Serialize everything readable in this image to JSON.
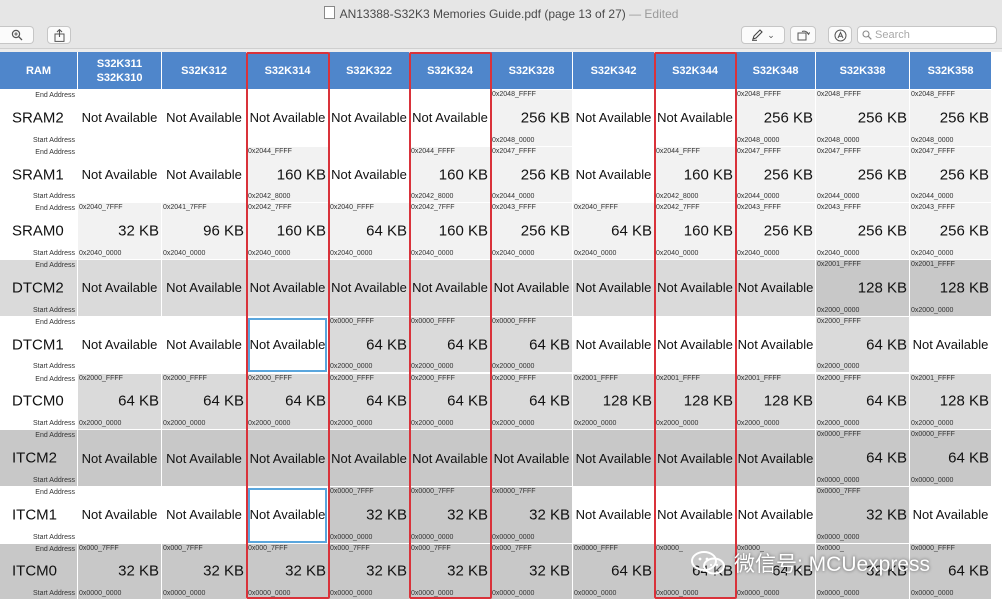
{
  "window": {
    "title": "AN13388-S32K3 Memories Guide.pdf (page 13 of 27)",
    "status": "— Edited"
  },
  "toolbar": {
    "zoom_icon": "zoom-icon",
    "share_icon": "share-icon",
    "markup_icon": "pen-icon",
    "rotate_icon": "rotate-icon",
    "annotate_icon": "annotate-icon",
    "search_placeholder": "Search"
  },
  "table": {
    "corner": "RAM",
    "end_address_label": "End Address",
    "start_address_label": "Start Address",
    "columns": [
      "S32K311\nS32K310",
      "S32K312",
      "S32K314",
      "S32K322",
      "S32K324",
      "S32K328",
      "S32K342",
      "S32K344",
      "S32K348",
      "S32K338",
      "S32K358"
    ],
    "rows": [
      {
        "name": "SRAM2",
        "cells": [
          {
            "na": "Not Available"
          },
          {
            "na": "Not Available"
          },
          {
            "na": "Not Available"
          },
          {
            "na": "Not Available"
          },
          {
            "na": "Not Available"
          },
          {
            "end": "0x2048_FFFF",
            "size": "256 KB",
            "start": "0x2048_0000"
          },
          {
            "na": "Not Available"
          },
          {
            "na": "Not Available"
          },
          {
            "end": "0x2048_FFFF",
            "size": "256 KB",
            "start": "0x2048_0000"
          },
          {
            "end": "0x2048_FFFF",
            "size": "256 KB",
            "start": "0x2048_0000"
          },
          {
            "end": "0x2048_FFFF",
            "size": "256 KB",
            "start": "0x2048_0000"
          }
        ]
      },
      {
        "name": "SRAM1",
        "cells": [
          {
            "na": "Not Available"
          },
          {
            "na": "Not Available"
          },
          {
            "end": "0x2044_FFFF",
            "size": "160 KB",
            "start": "0x2042_8000"
          },
          {
            "na": "Not Available"
          },
          {
            "end": "0x2044_FFFF",
            "size": "160 KB",
            "start": "0x2042_8000"
          },
          {
            "end": "0x2047_FFFF",
            "size": "256 KB",
            "start": "0x2044_0000"
          },
          {
            "na": "Not Available"
          },
          {
            "end": "0x2044_FFFF",
            "size": "160 KB",
            "start": "0x2042_8000"
          },
          {
            "end": "0x2047_FFFF",
            "size": "256 KB",
            "start": "0x2044_0000"
          },
          {
            "end": "0x2047_FFFF",
            "size": "256 KB",
            "start": "0x2044_0000"
          },
          {
            "end": "0x2047_FFFF",
            "size": "256 KB",
            "start": "0x2044_0000"
          }
        ]
      },
      {
        "name": "SRAM0",
        "cells": [
          {
            "end": "0x2040_7FFF",
            "size": "32 KB",
            "start": "0x2040_0000"
          },
          {
            "end": "0x2041_7FFF",
            "size": "96 KB",
            "start": "0x2040_0000"
          },
          {
            "end": "0x2042_7FFF",
            "size": "160 KB",
            "start": "0x2040_0000"
          },
          {
            "end": "0x2040_FFFF",
            "size": "64 KB",
            "start": "0x2040_0000"
          },
          {
            "end": "0x2042_7FFF",
            "size": "160 KB",
            "start": "0x2040_0000"
          },
          {
            "end": "0x2043_FFFF",
            "size": "256 KB",
            "start": "0x2040_0000"
          },
          {
            "end": "0x2040_FFFF",
            "size": "64 KB",
            "start": "0x2040_0000"
          },
          {
            "end": "0x2042_7FFF",
            "size": "160 KB",
            "start": "0x2040_0000"
          },
          {
            "end": "0x2043_FFFF",
            "size": "256 KB",
            "start": "0x2040_0000"
          },
          {
            "end": "0x2043_FFFF",
            "size": "256 KB",
            "start": "0x2040_0000"
          },
          {
            "end": "0x2043_FFFF",
            "size": "256 KB",
            "start": "0x2040_0000"
          }
        ]
      },
      {
        "name": "DTCM2",
        "cells": [
          {
            "na": "Not Available"
          },
          {
            "na": "Not Available"
          },
          {
            "na": "Not Available"
          },
          {
            "na": "Not Available"
          },
          {
            "na": "Not Available"
          },
          {
            "na": "Not Available"
          },
          {
            "na": "Not Available"
          },
          {
            "na": "Not Available"
          },
          {
            "na": "Not Available"
          },
          {
            "end": "0x2001_FFFF",
            "size": "128 KB",
            "start": "0x2000_0000"
          },
          {
            "end": "0x2001_FFFF",
            "size": "128 KB",
            "start": "0x2000_0000"
          }
        ]
      },
      {
        "name": "DTCM1",
        "cells": [
          {
            "na": "Not Available"
          },
          {
            "na": "Not Available"
          },
          {
            "na": "Not Available"
          },
          {
            "end": "0x0000_FFFF",
            "size": "64 KB",
            "start": "0x2000_0000"
          },
          {
            "end": "0x0000_FFFF",
            "size": "64 KB",
            "start": "0x2000_0000"
          },
          {
            "end": "0x0000_FFFF",
            "size": "64 KB",
            "start": "0x2000_0000"
          },
          {
            "na": "Not Available"
          },
          {
            "na": "Not Available"
          },
          {
            "na": "Not Available"
          },
          {
            "end": "0x2000_FFFF",
            "size": "64 KB",
            "start": "0x2000_0000"
          },
          {
            "na": "Not Available"
          }
        ]
      },
      {
        "name": "DTCM0",
        "cells": [
          {
            "end": "0x2000_FFFF",
            "size": "64 KB",
            "start": "0x2000_0000"
          },
          {
            "end": "0x2000_FFFF",
            "size": "64 KB",
            "start": "0x2000_0000"
          },
          {
            "end": "0x2000_FFFF",
            "size": "64 KB",
            "start": "0x2000_0000"
          },
          {
            "end": "0x2000_FFFF",
            "size": "64 KB",
            "start": "0x2000_0000"
          },
          {
            "end": "0x2000_FFFF",
            "size": "64 KB",
            "start": "0x2000_0000"
          },
          {
            "end": "0x2000_FFFF",
            "size": "64 KB",
            "start": "0x2000_0000"
          },
          {
            "end": "0x2001_FFFF",
            "size": "128 KB",
            "start": "0x2000_0000"
          },
          {
            "end": "0x2001_FFFF",
            "size": "128 KB",
            "start": "0x2000_0000"
          },
          {
            "end": "0x2001_FFFF",
            "size": "128 KB",
            "start": "0x2000_0000"
          },
          {
            "end": "0x2000_FFFF",
            "size": "64 KB",
            "start": "0x2000_0000"
          },
          {
            "end": "0x2001_FFFF",
            "size": "128 KB",
            "start": "0x2000_0000"
          }
        ]
      },
      {
        "name": "ITCM2",
        "cells": [
          {
            "na": "Not Available"
          },
          {
            "na": "Not Available"
          },
          {
            "na": "Not Available"
          },
          {
            "na": "Not Available"
          },
          {
            "na": "Not Available"
          },
          {
            "na": "Not Available"
          },
          {
            "na": "Not Available"
          },
          {
            "na": "Not Available"
          },
          {
            "na": "Not Available"
          },
          {
            "end": "0x0000_FFFF",
            "size": "64 KB",
            "start": "0x0000_0000"
          },
          {
            "end": "0x0000_FFFF",
            "size": "64 KB",
            "start": "0x0000_0000"
          }
        ]
      },
      {
        "name": "ITCM1",
        "cells": [
          {
            "na": "Not Available"
          },
          {
            "na": "Not Available"
          },
          {
            "na": "Not Available"
          },
          {
            "end": "0x0000_7FFF",
            "size": "32 KB",
            "start": "0x0000_0000"
          },
          {
            "end": "0x0000_7FFF",
            "size": "32 KB",
            "start": "0x0000_0000"
          },
          {
            "end": "0x0000_7FFF",
            "size": "32 KB",
            "start": "0x0000_0000"
          },
          {
            "na": "Not Available"
          },
          {
            "na": "Not Available"
          },
          {
            "na": "Not Available"
          },
          {
            "end": "0x0000_7FFF",
            "size": "32 KB",
            "start": "0x0000_0000"
          },
          {
            "na": "Not Available"
          }
        ]
      },
      {
        "name": "ITCM0",
        "cells": [
          {
            "end": "0x000_7FFF",
            "size": "32 KB",
            "start": "0x0000_0000"
          },
          {
            "end": "0x000_7FFF",
            "size": "32 KB",
            "start": "0x0000_0000"
          },
          {
            "end": "0x000_7FFF",
            "size": "32 KB",
            "start": "0x0000_0000"
          },
          {
            "end": "0x000_7FFF",
            "size": "32 KB",
            "start": "0x0000_0000"
          },
          {
            "end": "0x000_7FFF",
            "size": "32 KB",
            "start": "0x0000_0000"
          },
          {
            "end": "0x000_7FFF",
            "size": "32 KB",
            "start": "0x0000_0000"
          },
          {
            "end": "0x0000_FFFF",
            "size": "64 KB",
            "start": "0x0000_0000"
          },
          {
            "end": "0x0000_",
            "size": "64 KB",
            "start": "0x0000_0000"
          },
          {
            "end": "0x0000_",
            "size": "64 KB",
            "start": "0x0000_0000"
          },
          {
            "end": "0x0000_",
            "size": "32 KB",
            "start": "0x0000_0000"
          },
          {
            "end": "0x0000_FFFF",
            "size": "64 KB",
            "start": "0x0000_0000"
          }
        ]
      }
    ]
  },
  "watermark": "微信号: MCUexpress",
  "colors": {
    "header_blue": "#4f86cb",
    "highlight_red": "#d9323a",
    "selection_blue": "#5aa6dd"
  }
}
